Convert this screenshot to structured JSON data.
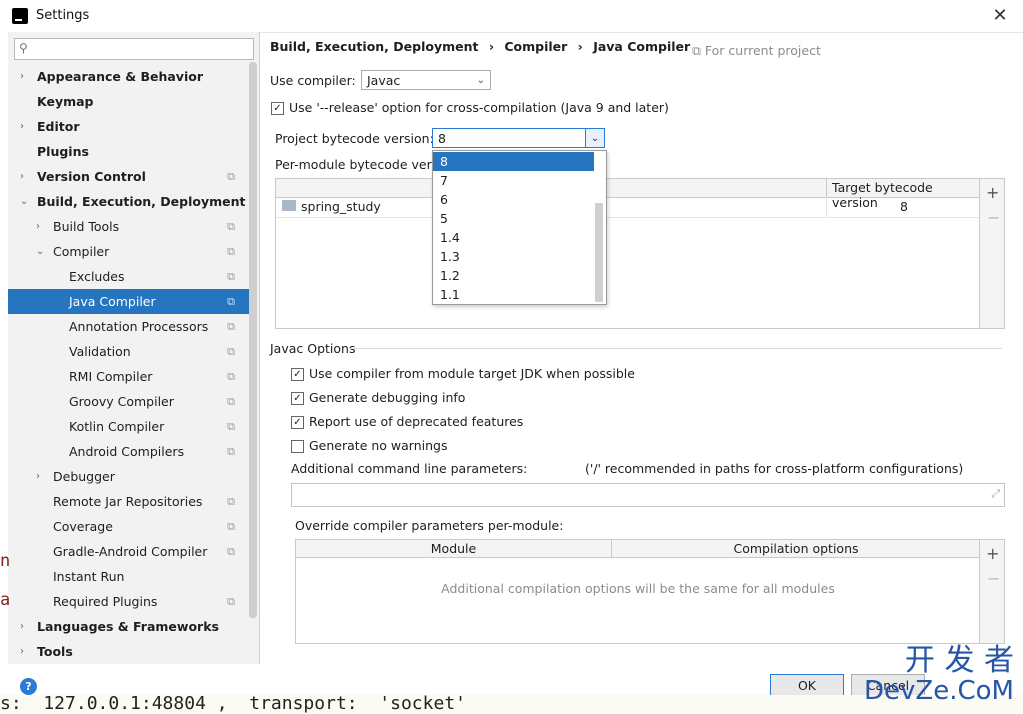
{
  "window": {
    "title": "Settings",
    "close_symbol": "✕"
  },
  "search": {
    "placeholder": ""
  },
  "sidebar": {
    "items": [
      {
        "label": "Appearance & Behavior",
        "bold": true,
        "arrow": "›"
      },
      {
        "label": "Keymap",
        "bold": true
      },
      {
        "label": "Editor",
        "bold": true,
        "arrow": "›"
      },
      {
        "label": "Plugins",
        "bold": true
      },
      {
        "label": "Version Control",
        "bold": true,
        "arrow": "›"
      },
      {
        "label": "Build, Execution, Deployment",
        "bold": true,
        "arrow": "⌄"
      },
      {
        "label": "Build Tools",
        "arrow": "›"
      },
      {
        "label": "Compiler",
        "arrow": "⌄"
      },
      {
        "label": "Excludes"
      },
      {
        "label": "Java Compiler",
        "selected": true
      },
      {
        "label": "Annotation Processors"
      },
      {
        "label": "Validation"
      },
      {
        "label": "RMI Compiler"
      },
      {
        "label": "Groovy Compiler"
      },
      {
        "label": "Kotlin Compiler"
      },
      {
        "label": "Android Compilers"
      },
      {
        "label": "Debugger",
        "arrow": "›"
      },
      {
        "label": "Remote Jar Repositories"
      },
      {
        "label": "Coverage"
      },
      {
        "label": "Gradle-Android Compiler"
      },
      {
        "label": "Instant Run"
      },
      {
        "label": "Required Plugins"
      },
      {
        "label": "Languages & Frameworks",
        "bold": true,
        "arrow": "›"
      },
      {
        "label": "Tools",
        "bold": true,
        "arrow": "›"
      }
    ]
  },
  "breadcrumb": {
    "part1": "Build, Execution, Deployment",
    "sep": "›",
    "part2": "Compiler",
    "part3": "Java Compiler"
  },
  "for_current_project": "For current project",
  "use_compiler": {
    "label": "Use compiler:",
    "value": "Javac"
  },
  "release_option": {
    "label": "Use '--release' option for cross-compilation (Java 9 and later)",
    "checked": true
  },
  "project_bytecode": {
    "label": "Project bytecode version:",
    "value": "8"
  },
  "per_module_label": "Per-module bytecode versi",
  "bytecode_table": {
    "header_target": "Target bytecode version",
    "rows": [
      {
        "module": "spring_study",
        "target": "8"
      }
    ]
  },
  "dropdown_options": [
    "8",
    "7",
    "6",
    "5",
    "1.4",
    "1.3",
    "1.2",
    "1.1"
  ],
  "dropdown_selected": "8",
  "javac": {
    "title": "Javac Options",
    "options": [
      {
        "label": "Use compiler from module target JDK when possible",
        "checked": true
      },
      {
        "label": "Generate debugging info",
        "checked": true
      },
      {
        "label": "Report use of deprecated features",
        "checked": true
      },
      {
        "label": "Generate no warnings",
        "checked": false
      }
    ],
    "additional_label": "Additional command line parameters:",
    "additional_hint": "('/' recommended in paths for cross-platform configurations)",
    "additional_value": ""
  },
  "override": {
    "title": "Override compiler parameters per-module:",
    "col_module": "Module",
    "col_options": "Compilation options",
    "empty_text": "Additional compilation options will be the same for all modules"
  },
  "buttons": {
    "ok": "OK",
    "cancel": "Cancel",
    "help": "?"
  },
  "background_console": "s:  127.0.0.1:48804 ,  transport:  'socket'",
  "watermark": {
    "line1": "开 发 者",
    "line2": "DevZe.CoM"
  }
}
